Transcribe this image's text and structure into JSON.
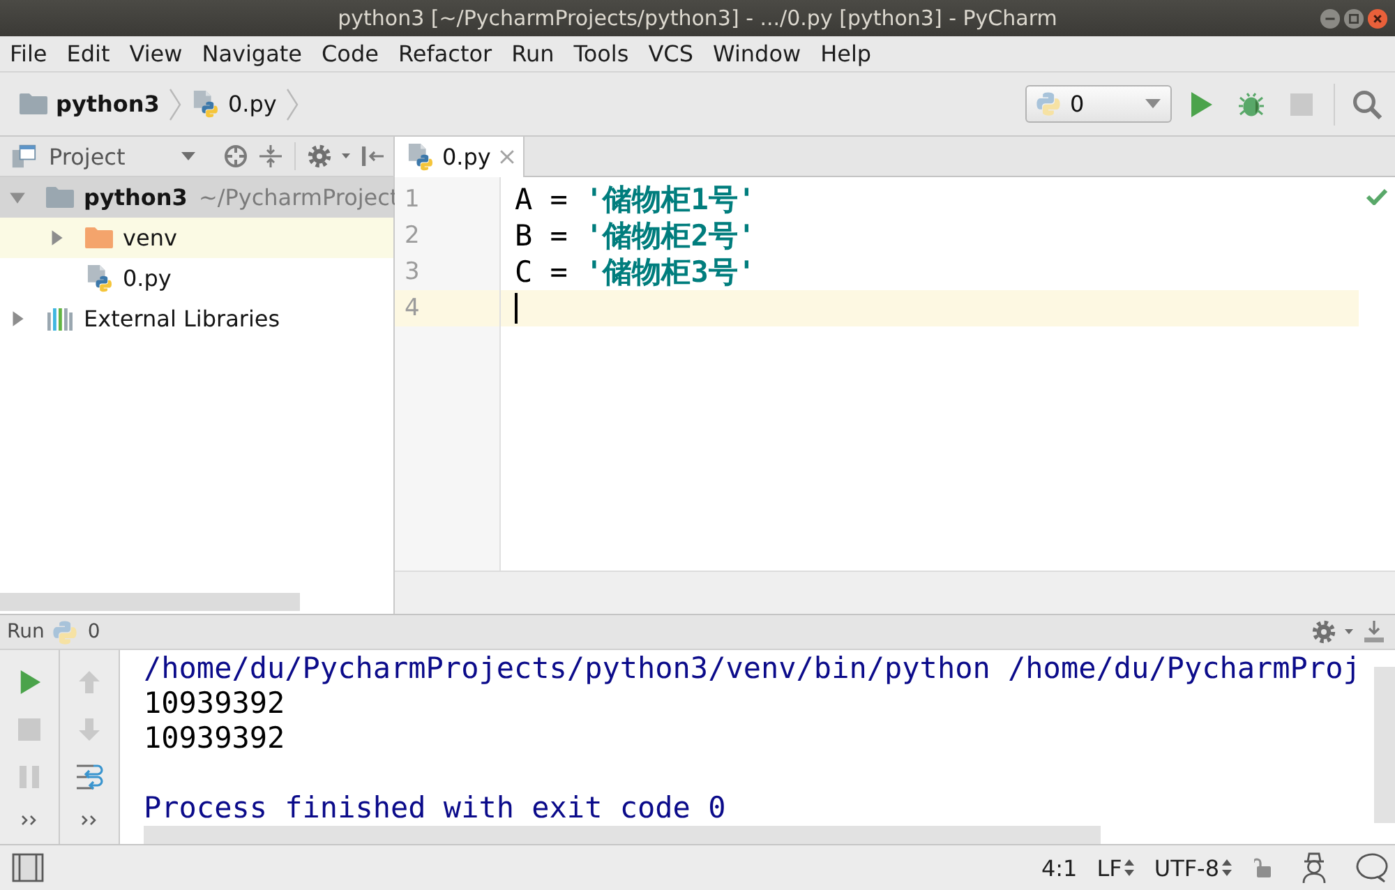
{
  "window": {
    "title": "python3 [~/PycharmProjects/python3] - .../0.py [python3] - PyCharm"
  },
  "menu": [
    {
      "label": "File"
    },
    {
      "label": "Edit"
    },
    {
      "label": "View"
    },
    {
      "label": "Navigate"
    },
    {
      "label": "Code"
    },
    {
      "label": "Refactor"
    },
    {
      "label": "Run"
    },
    {
      "label": "Tools"
    },
    {
      "label": "VCS"
    },
    {
      "label": "Window"
    },
    {
      "label": "Help"
    }
  ],
  "navigation_bar": {
    "breadcrumbs": [
      {
        "label": "python3",
        "kind": "project"
      },
      {
        "label": "0.py",
        "kind": "python_file"
      }
    ],
    "run_configuration": "0",
    "actions": [
      {
        "kind": "run",
        "disabled": false
      },
      {
        "kind": "debug",
        "disabled": false
      },
      {
        "kind": "stop",
        "disabled": true
      },
      {
        "kind": "search",
        "disabled": false
      }
    ]
  },
  "project_panel": {
    "view": "Project",
    "tree": [
      {
        "label": "python3",
        "path": "~/PycharmProject",
        "kind": "project",
        "expanded": true,
        "selected": true,
        "highlighted": false,
        "children": [
          {
            "label": "venv",
            "kind": "excluded_folder",
            "expanded": false,
            "selected": false,
            "highlighted": true
          },
          {
            "label": "0.py",
            "kind": "python_file",
            "selected": false,
            "highlighted": false
          }
        ]
      },
      {
        "label": "External Libraries",
        "kind": "libraries",
        "expanded": false,
        "selected": false,
        "highlighted": false
      }
    ]
  },
  "editor": {
    "tabs": [
      {
        "label": "0.py",
        "selected": true
      }
    ],
    "lines": [
      {
        "number": "1",
        "code": "A = **'储物柜1号'**",
        "current": false
      },
      {
        "number": "2",
        "code": "B = **'储物柜2号'**",
        "current": false
      },
      {
        "number": "3",
        "code": "C = **'储物柜3号'**",
        "current": false
      },
      {
        "number": "4",
        "current": true
      }
    ]
  },
  "run_panel": {
    "title": "Run",
    "tab": "0",
    "toolbar": [
      {
        "kind": "rerun",
        "disabled": false
      },
      {
        "kind": "stop",
        "disabled": true
      },
      {
        "kind": "pause",
        "disabled": true
      },
      {
        "kind": "more",
        "disabled": false
      }
    ],
    "toolbar_2": [
      {
        "kind": "up",
        "disabled": true
      },
      {
        "kind": "down",
        "disabled": true
      },
      {
        "kind": "soft_wrap",
        "disabled": false
      },
      {
        "kind": "more",
        "disabled": false
      }
    ],
    "output": [
      {
        "kind": "command",
        "text": "/home/du/PycharmProjects/python3/venv/bin/python /home/du/PycharmProj"
      },
      {
        "kind": "stdout",
        "text": "10939392"
      },
      {
        "kind": "stdout",
        "text": "10939392"
      },
      {
        "kind": "system",
        "text": "Process finished with exit code 0"
      }
    ]
  },
  "status_bar": {
    "position": "4:1",
    "line_separator": "LF",
    "encoding": "UTF-8"
  }
}
